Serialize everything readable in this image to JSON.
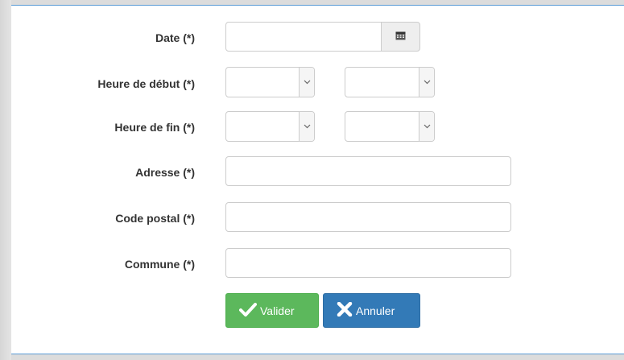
{
  "form": {
    "date_label": "Date (*)",
    "date_value": "",
    "calendar_icon": "calendar-icon",
    "start_label": "Heure de début (*)",
    "start_hour_value": "",
    "start_minute_value": "",
    "end_label": "Heure de fin (*)",
    "end_hour_value": "",
    "end_minute_value": "",
    "address_label": "Adresse (*)",
    "address_value": "",
    "postal_label": "Code postal (*)",
    "postal_value": "",
    "commune_label": "Commune (*)",
    "commune_value": ""
  },
  "buttons": {
    "validate_label": "Valider",
    "validate_icon": "checkmark-icon",
    "cancel_label": "Annuler",
    "cancel_icon": "cross-icon"
  },
  "colors": {
    "success": "#5cb85c",
    "primary": "#337ab7",
    "panel_border": "#5a9bd5"
  }
}
